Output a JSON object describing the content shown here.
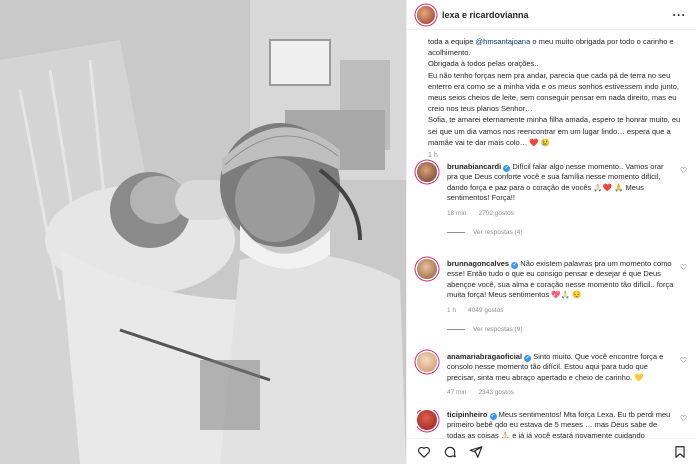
{
  "post": {
    "author": "lexa e ricardovianna",
    "caption": {
      "line1_prefix": "toda a equipe ",
      "line1_mention": "@hmsantajoana",
      "line1_suffix": " o meu muito obrigada por todo o carinho e acolhimento.",
      "line2": "Obrigada à todos pelas orações..",
      "line3": "Eu não tenho forças nem pra andar, parecia que cada pá de terra no seu enterro era como se a minha vida e os meus sonhos estivessem indo junto, meus seios cheios de leite, sem conseguir pensar em nada direito, mas eu creio nos teus planos Senhor…",
      "line4": "Sofia, te amarei eternamente minha filha amada, espero te honrar muito, eu sei que um dia vamos nos reencontrar em um lugar lindo… espera que a mamãe vai te dar mais colo… ❤️ 😢"
    },
    "time": "1 h"
  },
  "comments": [
    {
      "username": "brunabiancardi",
      "text": " Difícil falar algo nesse momento.. Vamos orar pra que Deus conforte você e sua família nesse momento difícil, dando força e paz para o coração de vocês 🙏🏻❤️ 🙏 Meus sentimentos! Força!!",
      "time": "18 min",
      "likes": "2702 gostos",
      "replies": "Ver respostas (4)",
      "avatar_color": "#6b3a2a"
    },
    {
      "username": "brunnagoncalves",
      "text": " Não existem palavras pra um momento como esse! Então tudo o que eu consigo pensar e desejar é que Deus abençoe você, sua alma e coração nesse momento tão difícil.. força muita força! Meus sentimentos 💖🙏🏻 😔",
      "time": "1 h",
      "likes": "4049 gostos",
      "replies": "Ver respostas (9)",
      "avatar_color": "#b5835a"
    },
    {
      "username": "anamariabragaoficial",
      "text": " Sinto muito. Que você encontre força e consolo nesse momento tão difícil. Estou aqui para tudo que precisar, sinta meu abraço apertado e cheio de carinho. 💛",
      "time": "47 min",
      "likes": "2343 gostos",
      "replies": "",
      "avatar_color": "#e7b98a"
    },
    {
      "username": "ticipinheiro",
      "text": " Meus sentimentos! Mta força Lexa. Eu tb perdi meu primeiro bebê qdo eu estava de 5 meses … mas Deus sabe de todas as coisas 🙏🏻 e já já você estará novamente cuidando",
      "time": "",
      "likes": "",
      "replies": "",
      "avatar_color": "#c0392b"
    }
  ],
  "icons": {
    "more": "more-icon",
    "heart": "heart-icon",
    "comment": "comment-icon",
    "share": "share-icon",
    "save": "save-icon"
  },
  "colors": {
    "link": "#00376b",
    "verified": "#3897f0",
    "story_ring": "#d62976",
    "muted": "#8e8e8e"
  }
}
